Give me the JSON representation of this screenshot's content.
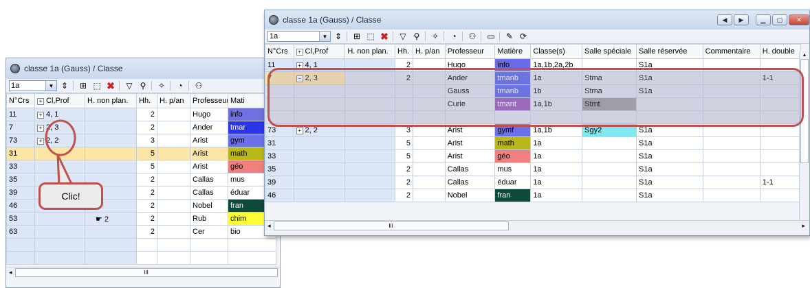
{
  "back_window": {
    "title": "classe 1a (Gauss) / Classe",
    "combo_value": "1a",
    "columns": [
      "N°Crs",
      "Cl,Prof",
      "H. non plan.",
      "Hh.",
      "H. p/an",
      "Professeur",
      "Mati"
    ],
    "rows": [
      {
        "crs": "11",
        "cl": "4, 1",
        "hnon": "",
        "hh": "2",
        "hpan": "",
        "prof": "Hugo",
        "mat": "info",
        "mat_color": "#7070e0"
      },
      {
        "crs": "7",
        "cl": "2, 3",
        "hnon": "",
        "hh": "2",
        "hpan": "",
        "prof": "Ander",
        "mat": "tmar",
        "mat_color": "#2b35e8"
      },
      {
        "crs": "73",
        "cl": "2, 2",
        "hnon": "",
        "hh": "3",
        "hpan": "",
        "prof": "Arist",
        "mat": "gym",
        "mat_color": "#6a70e8"
      },
      {
        "crs": "31",
        "cl": "",
        "hnon": "",
        "hh": "5",
        "hpan": "",
        "prof": "Arist",
        "mat": "math",
        "mat_color": "#b8b81a"
      },
      {
        "crs": "33",
        "cl": "",
        "hnon": "",
        "hh": "5",
        "hpan": "",
        "prof": "Arist",
        "mat": "géo",
        "mat_color": "#f08080"
      },
      {
        "crs": "35",
        "cl": "",
        "hnon": "",
        "hh": "2",
        "hpan": "",
        "prof": "Callas",
        "mat": "mus",
        "mat_color": "#ffffff"
      },
      {
        "crs": "39",
        "cl": "",
        "hnon": "",
        "hh": "2",
        "hpan": "",
        "prof": "Callas",
        "mat": "éduar",
        "mat_color": "#ffffff"
      },
      {
        "crs": "46",
        "cl": "",
        "hnon": "",
        "hh": "2",
        "hpan": "",
        "prof": "Nobel",
        "mat": "fran",
        "mat_color": "#0d4a3a"
      },
      {
        "crs": "53",
        "cl": "",
        "hnon": "2",
        "hh": "2",
        "hpan": "",
        "prof": "Rub",
        "mat": "chim",
        "mat_color": "#ffff33"
      },
      {
        "crs": "63",
        "cl": "",
        "hnon": "",
        "hh": "2",
        "hpan": "",
        "prof": "Cer",
        "mat": "bio",
        "mat_color": "#ffffff"
      }
    ]
  },
  "front_window": {
    "title": "classe 1a (Gauss) / Classe",
    "combo_value": "1a",
    "columns": [
      "N°Crs",
      "Cl,Prof",
      "H. non plan.",
      "Hh.",
      "H. p/an",
      "Professeur",
      "Matière",
      "Classe(s)",
      "Salle spéciale",
      "Salle réservée",
      "Commentaire",
      "H. double"
    ],
    "rows": [
      {
        "crs": "11",
        "cl": "4, 1",
        "hnon": "",
        "hh": "2",
        "hpan": "",
        "prof": "Hugo",
        "mat": "info",
        "mat_color": "#6b6be8",
        "cls": "1a,1b,2a,2b",
        "sspec": "",
        "sres": "S1a",
        "comm": "",
        "hdbl": ""
      },
      {
        "crs": "7",
        "cl": "2, 3",
        "hnon": "",
        "hh": "2",
        "hpan": "",
        "prof": "Ander",
        "mat": "tmanb",
        "mat_color": "#5b63e6",
        "cls": "1a",
        "sspec": "Stma",
        "sres": "S1a",
        "comm": "",
        "hdbl": "1-1"
      },
      {
        "crs": "",
        "cl": "",
        "hnon": "",
        "hh": "",
        "hpan": "",
        "prof": "Gauss",
        "mat": "tmanb",
        "mat_color": "#5b63e6",
        "cls": "1b",
        "sspec": "Stma",
        "sres": "S1a",
        "comm": "",
        "hdbl": ""
      },
      {
        "crs": "",
        "cl": "",
        "hnon": "",
        "hh": "",
        "hpan": "",
        "prof": "Curie",
        "mat": "tmant",
        "mat_color": "#9b59b6",
        "cls": "1a,1b",
        "sspec": "Stmt",
        "sres": "",
        "comm": "",
        "hdbl": ""
      },
      {
        "crs": "",
        "cl": "",
        "hnon": "",
        "hh": "",
        "hpan": "",
        "prof": "",
        "mat": "",
        "mat_color": "",
        "cls": "",
        "sspec": "",
        "sres": "",
        "comm": "",
        "hdbl": ""
      },
      {
        "crs": "73",
        "cl": "2, 2",
        "hnon": "",
        "hh": "3",
        "hpan": "",
        "prof": "Arist",
        "mat": "gymf",
        "mat_color": "#6a70e8",
        "cls": "1a,1b",
        "sspec": "Sgy2",
        "sres": "S1a",
        "comm": "",
        "hdbl": ""
      },
      {
        "crs": "31",
        "cl": "",
        "hnon": "",
        "hh": "5",
        "hpan": "",
        "prof": "Arist",
        "mat": "math",
        "mat_color": "#b8b81a",
        "cls": "1a",
        "sspec": "",
        "sres": "S1a",
        "comm": "",
        "hdbl": ""
      },
      {
        "crs": "33",
        "cl": "",
        "hnon": "",
        "hh": "5",
        "hpan": "",
        "prof": "Arist",
        "mat": "géo",
        "mat_color": "#f08080",
        "cls": "1a",
        "sspec": "",
        "sres": "S1a",
        "comm": "",
        "hdbl": ""
      },
      {
        "crs": "35",
        "cl": "",
        "hnon": "",
        "hh": "2",
        "hpan": "",
        "prof": "Callas",
        "mat": "mus",
        "mat_color": "#ffffff",
        "cls": "1a",
        "sspec": "",
        "sres": "S1a",
        "comm": "",
        "hdbl": ""
      },
      {
        "crs": "39",
        "cl": "",
        "hnon": "",
        "hh": "2",
        "hpan": "",
        "prof": "Callas",
        "mat": "éduar",
        "mat_color": "#ffffff",
        "cls": "1a",
        "sspec": "",
        "sres": "S1a",
        "comm": "",
        "hdbl": "1-1"
      },
      {
        "crs": "46",
        "cl": "",
        "hnon": "",
        "hh": "2",
        "hpan": "",
        "prof": "Nobel",
        "mat": "fran",
        "mat_color": "#0d4a3a",
        "cls": "1a",
        "sspec": "",
        "sres": "S1a",
        "comm": "",
        "hdbl": ""
      }
    ],
    "scroll_mark": "III"
  },
  "callout": {
    "text": "Clic!"
  },
  "accent_color": "#c0504d"
}
